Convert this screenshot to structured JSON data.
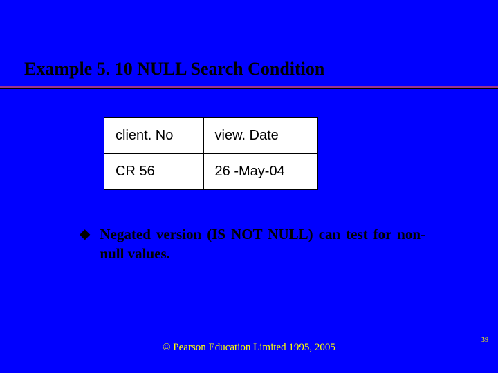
{
  "title": "Example 5. 10  NULL Search Condition",
  "chart_data": {
    "type": "table",
    "columns": [
      "client. No",
      "view. Date"
    ],
    "rows": [
      {
        "clientNo": "CR 56",
        "viewDate": "26 -May-04"
      }
    ]
  },
  "bullet": {
    "glyph": "◆",
    "text": "Negated version (IS NOT NULL) can test for non-null values."
  },
  "footer": "© Pearson Education Limited 1995, 2005",
  "page_number": "39"
}
